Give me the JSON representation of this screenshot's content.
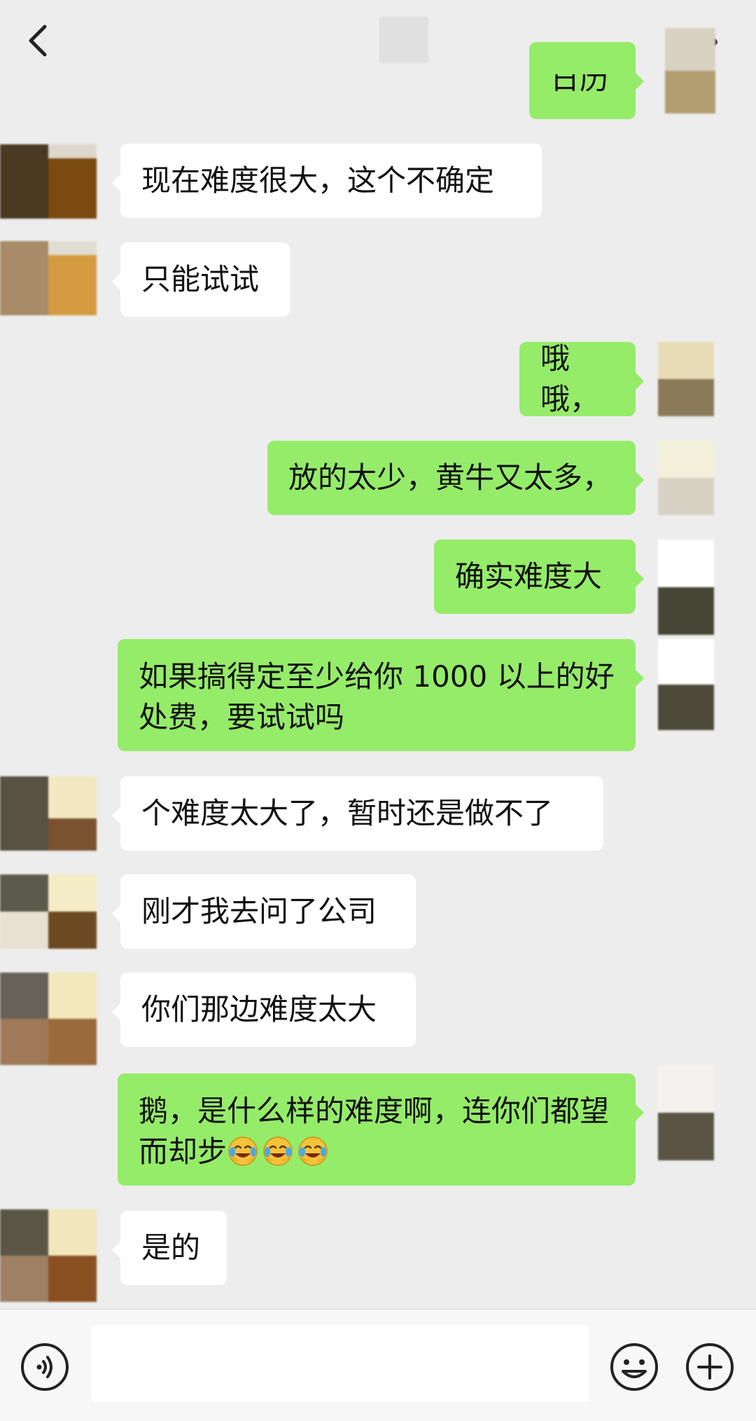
{
  "header": {
    "back_icon": "chevron-left-icon",
    "more_icon": "more-dots-icon"
  },
  "messages": [
    {
      "side": "right",
      "text": "日历",
      "partial": true
    },
    {
      "side": "left",
      "text": "现在难度很大，这个不确定"
    },
    {
      "side": "left",
      "text": "只能试试"
    },
    {
      "side": "right",
      "text": "哦哦，"
    },
    {
      "side": "right",
      "text": "放的太少，黄牛又太多，"
    },
    {
      "side": "right",
      "text": "确实难度大"
    },
    {
      "side": "right",
      "text": "如果搞得定至少给你 1000 以上的好处费，要试试吗"
    },
    {
      "side": "left",
      "text": "个难度太大了，暂时还是做不了"
    },
    {
      "side": "left",
      "text": "刚才我去问了公司"
    },
    {
      "side": "left",
      "text": "你们那边难度太大"
    },
    {
      "side": "right",
      "text": "鹅，是什么样的难度啊，连你们都望而却步",
      "emoji": "crying-laughing-face-icon",
      "emoji_count": 3
    },
    {
      "side": "left",
      "text": "是的"
    }
  ],
  "input_bar": {
    "voice_icon": "voice-icon",
    "emoji_icon": "smiley-icon",
    "plus_icon": "plus-icon",
    "input_value": ""
  },
  "colors": {
    "background": "#ededed",
    "bubble_self": "#95ec69",
    "bubble_other": "#ffffff",
    "bottom_bar": "#f7f7f7"
  }
}
